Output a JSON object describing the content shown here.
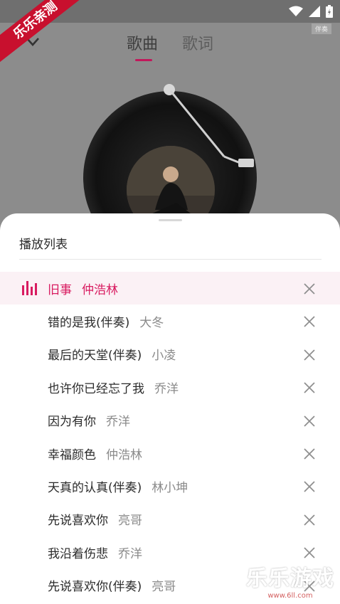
{
  "tabs": {
    "songs": "歌曲",
    "lyrics": "歌词"
  },
  "player": {
    "tag": "伴奏"
  },
  "playlist": {
    "title": "播放列表",
    "items": [
      {
        "song": "旧事",
        "artist": "仲浩林",
        "playing": true
      },
      {
        "song": "错的是我(伴奏)",
        "artist": "大冬"
      },
      {
        "song": "最后的天堂(伴奏)",
        "artist": "小凌"
      },
      {
        "song": "也许你已经忘了我",
        "artist": "乔洋"
      },
      {
        "song": "因为有你",
        "artist": "乔洋"
      },
      {
        "song": "幸福颜色",
        "artist": "仲浩林"
      },
      {
        "song": "天真的认真(伴奏)",
        "artist": "林小坤"
      },
      {
        "song": "先说喜欢你",
        "artist": "亮哥"
      },
      {
        "song": "我沿着伤悲",
        "artist": "乔洋"
      },
      {
        "song": "先说喜欢你(伴奏)",
        "artist": "亮哥"
      }
    ]
  },
  "watermark": {
    "corner": "乐乐亲测",
    "brand": "乐乐游戏",
    "url": "www.6ll.com"
  },
  "colors": {
    "accent": "#d81b60",
    "overlay": "#8a8a8a"
  },
  "icons": {
    "playing": "equalizer-icon",
    "remove": "close-icon",
    "back": "chevron-down-icon"
  }
}
